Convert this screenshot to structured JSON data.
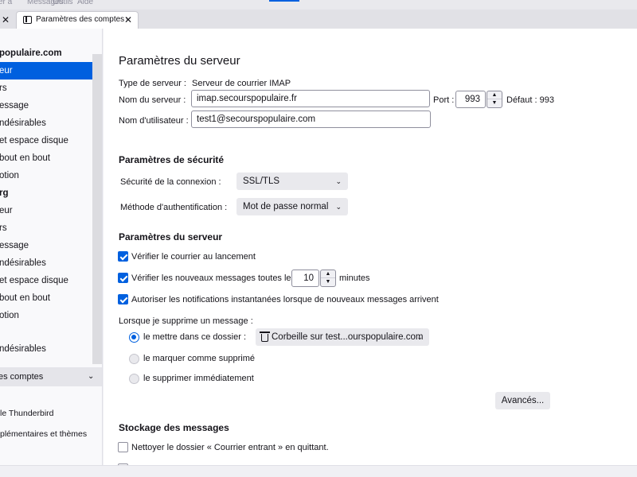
{
  "menubar": {
    "items": [
      "er à",
      "Messages",
      "Outils",
      "Aide"
    ]
  },
  "tabs": {
    "active_label": "Paramètres des comptes Co"
  },
  "sidebar": {
    "items": [
      {
        "label": "populaire.com",
        "kind": "account"
      },
      {
        "label": "eur",
        "kind": "selected"
      },
      {
        "label": "rs"
      },
      {
        "label": "essage"
      },
      {
        "label": "ndésirables"
      },
      {
        "label": "et espace disque"
      },
      {
        "label": "bout en bout"
      },
      {
        "label": "otion"
      },
      {
        "label": "rg",
        "kind": "account"
      },
      {
        "label": "eur"
      },
      {
        "label": "rs"
      },
      {
        "label": "essage"
      },
      {
        "label": "ndésirables"
      },
      {
        "label": "et espace disque"
      },
      {
        "label": "bout en bout"
      },
      {
        "label": "otion"
      },
      {
        "label": "ndésirables"
      }
    ],
    "accounts_section": "es comptes",
    "footer": [
      "le Thunderbird",
      "plémentaires et thèmes"
    ]
  },
  "main": {
    "title": "Paramètres du serveur",
    "server_type_label": "Type de serveur :",
    "server_type_value": "Serveur de courrier IMAP",
    "server_name_label": "Nom du serveur :",
    "server_name_value": "imap.secourspopulaire.fr",
    "port_label": "Port :",
    "port_value": "993",
    "default_port": "Défaut : 993",
    "username_label": "Nom d'utilisateur :",
    "username_value": "test1@secourspopulaire.com",
    "security": {
      "title": "Paramètres de sécurité",
      "connection_label": "Sécurité de la connexion :",
      "connection_value": "SSL/TLS",
      "auth_label": "Méthode d'authentification :",
      "auth_value": "Mot de passe normal"
    },
    "server_settings": {
      "title": "Paramètres du serveur",
      "check_startup": "Vérifier le courrier au lancement",
      "check_every_prefix": "Vérifier les nouveaux messages toutes les",
      "check_every_value": "10",
      "check_every_suffix": "minutes",
      "push_notifications": "Autoriser les notifications instantanées lorsque de nouveaux messages arrivent",
      "delete_label": "Lorsque je supprime un message :",
      "delete_move": "le mettre dans ce dossier :",
      "delete_folder": "Corbeille sur test...ourspopulaire.com",
      "delete_mark": "le marquer comme supprimé",
      "delete_immediate": "le supprimer immédiatement",
      "advanced_button": "Avancés..."
    },
    "storage": {
      "title": "Stockage des messages",
      "clean_inbox": "Nettoyer le dossier « Courrier entrant » en quittant."
    }
  },
  "colors": {
    "accent": "#0060df",
    "sidebar_bg": "#f9f9fb",
    "content_bg": "#ffffff"
  }
}
